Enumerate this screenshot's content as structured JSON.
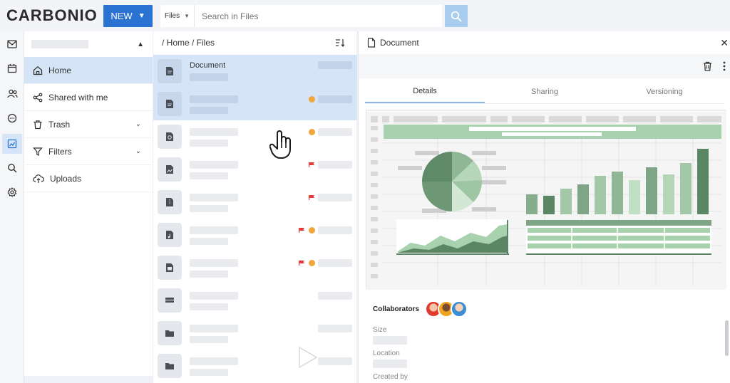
{
  "brand": {
    "logo": "CARBONIO"
  },
  "header": {
    "new_label": "NEW",
    "search_scope": "Files",
    "search_placeholder": "Search in Files"
  },
  "sidebar": {
    "items": [
      {
        "label": "Home",
        "icon": "home-icon",
        "active": true
      },
      {
        "label": "Shared with me",
        "icon": "share-icon"
      },
      {
        "label": "Trash",
        "icon": "trash-icon",
        "expandable": true
      },
      {
        "label": "Filters",
        "icon": "filter-icon",
        "expandable": true
      },
      {
        "label": "Uploads",
        "icon": "upload-cloud-icon"
      }
    ]
  },
  "list": {
    "breadcrumb": "/ Home / Files",
    "rows": [
      {
        "name": "Document",
        "selected": true,
        "icon": "document-icon"
      },
      {
        "name": "",
        "selected": true,
        "icon": "document-icon",
        "badges": [
          "dot"
        ]
      },
      {
        "name": "",
        "icon": "presentation-icon",
        "badges": [
          "dot"
        ]
      },
      {
        "name": "",
        "icon": "image-file-icon",
        "badges": [
          "flag"
        ]
      },
      {
        "name": "",
        "icon": "archive-icon",
        "badges": [
          "flag"
        ]
      },
      {
        "name": "",
        "icon": "audio-file-icon",
        "badges": [
          "flag",
          "dot"
        ]
      },
      {
        "name": "",
        "icon": "video-file-icon",
        "badges": [
          "flag",
          "dot"
        ]
      },
      {
        "name": "",
        "icon": "hard-drive-icon"
      },
      {
        "name": "",
        "icon": "folder-icon"
      },
      {
        "name": "",
        "icon": "folder-icon"
      }
    ]
  },
  "details": {
    "title": "Document",
    "tabs": [
      "Details",
      "Sharing",
      "Versioning"
    ],
    "active_tab": "Details",
    "collaborators_label": "Collaborators",
    "size_label": "Size",
    "location_label": "Location",
    "created_by_label": "Created by"
  },
  "colors": {
    "accent": "#2b73d2",
    "selection": "#d6e4f7",
    "flag": "#e53935",
    "dot": "#f1a53a",
    "preview_green": "#5f8a67"
  }
}
